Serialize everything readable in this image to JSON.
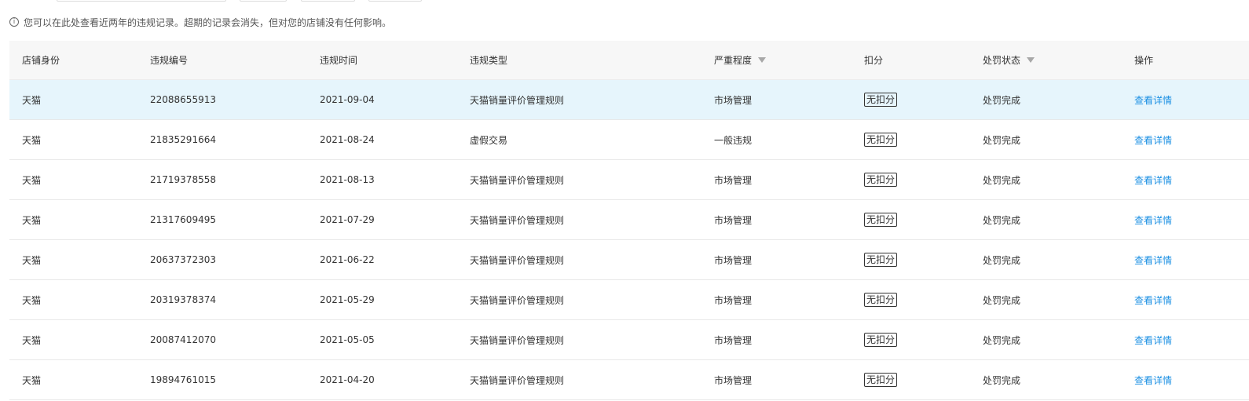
{
  "notice": {
    "icon": "info-icon",
    "text": "您可以在此处查看近两年的违规记录。超期的记录会消失，但对您的店铺没有任何影响。"
  },
  "table": {
    "columns": {
      "shop_identity": "店铺身份",
      "violation_id": "违规编号",
      "violation_time": "违规时间",
      "violation_type": "违规类型",
      "severity": "严重程度",
      "deduction": "扣分",
      "penalty_status": "处罚状态",
      "action": "操作"
    },
    "rows": [
      {
        "shop": "天猫",
        "id": "22088655913",
        "time": "2021-09-04",
        "type": "天猫销量评价管理规则",
        "severity": "市场管理",
        "deduction": "无扣分",
        "status": "处罚完成",
        "action": "查看详情"
      },
      {
        "shop": "天猫",
        "id": "21835291664",
        "time": "2021-08-24",
        "type": "虚假交易",
        "severity": "一般违规",
        "deduction": "无扣分",
        "status": "处罚完成",
        "action": "查看详情"
      },
      {
        "shop": "天猫",
        "id": "21719378558",
        "time": "2021-08-13",
        "type": "天猫销量评价管理规则",
        "severity": "市场管理",
        "deduction": "无扣分",
        "status": "处罚完成",
        "action": "查看详情"
      },
      {
        "shop": "天猫",
        "id": "21317609495",
        "time": "2021-07-29",
        "type": "天猫销量评价管理规则",
        "severity": "市场管理",
        "deduction": "无扣分",
        "status": "处罚完成",
        "action": "查看详情"
      },
      {
        "shop": "天猫",
        "id": "20637372303",
        "time": "2021-06-22",
        "type": "天猫销量评价管理规则",
        "severity": "市场管理",
        "deduction": "无扣分",
        "status": "处罚完成",
        "action": "查看详情"
      },
      {
        "shop": "天猫",
        "id": "20319378374",
        "time": "2021-05-29",
        "type": "天猫销量评价管理规则",
        "severity": "市场管理",
        "deduction": "无扣分",
        "status": "处罚完成",
        "action": "查看详情"
      },
      {
        "shop": "天猫",
        "id": "20087412070",
        "time": "2021-05-05",
        "type": "天猫销量评价管理规则",
        "severity": "市场管理",
        "deduction": "无扣分",
        "status": "处罚完成",
        "action": "查看详情"
      },
      {
        "shop": "天猫",
        "id": "19894761015",
        "time": "2021-04-20",
        "type": "天猫销量评价管理规则",
        "severity": "市场管理",
        "deduction": "无扣分",
        "status": "处罚完成",
        "action": "查看详情"
      }
    ]
  },
  "colors": {
    "highlight_row": "#e6f5fc",
    "link": "#1a8fe3",
    "header_bg": "#f7f7f7"
  }
}
